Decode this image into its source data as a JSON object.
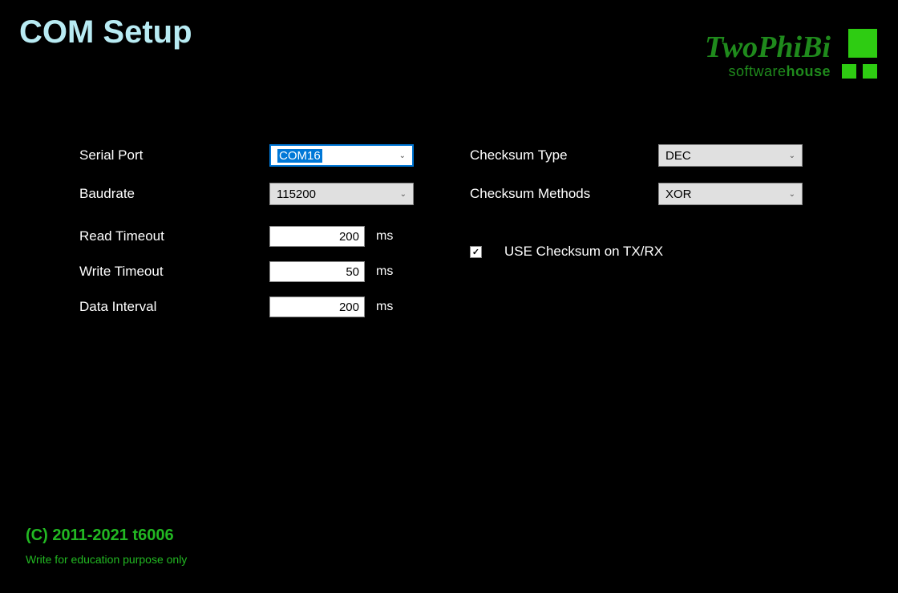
{
  "title": "COM Setup",
  "logo": {
    "brand": "TwoPhiBi",
    "sub_prefix": "software",
    "sub_bold": "house"
  },
  "left": {
    "serial_port": {
      "label": "Serial Port",
      "value": "COM16"
    },
    "baudrate": {
      "label": "Baudrate",
      "value": "115200"
    },
    "read_timeout": {
      "label": "Read Timeout",
      "value": "200",
      "unit": "ms"
    },
    "write_timeout": {
      "label": "Write Timeout",
      "value": "50",
      "unit": "ms"
    },
    "data_interval": {
      "label": "Data Interval",
      "value": "200",
      "unit": "ms"
    }
  },
  "right": {
    "checksum_type": {
      "label": "Checksum  Type",
      "value": "DEC"
    },
    "checksum_methods": {
      "label": "Checksum Methods",
      "value": "XOR"
    },
    "use_checksum": {
      "label": "USE Checksum on TX/RX",
      "checked": true
    }
  },
  "footer": {
    "copyright": "(C) 2011-2021 t6006",
    "note": "Write for education purpose only"
  }
}
